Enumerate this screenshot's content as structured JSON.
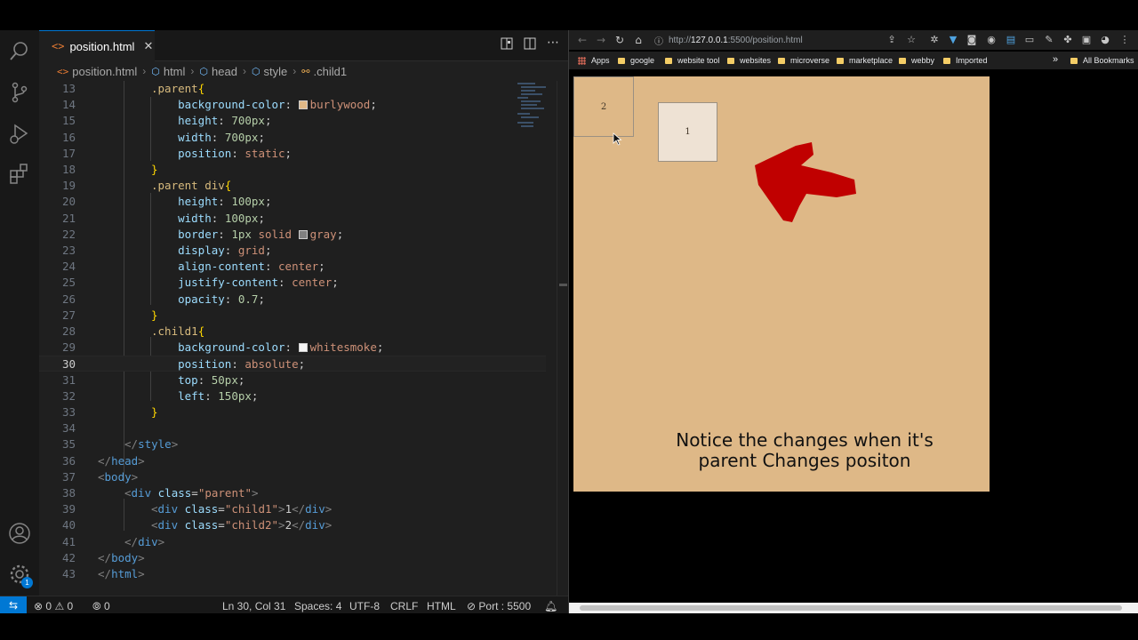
{
  "editor": {
    "tab": {
      "label": "position.html",
      "close": "✕"
    },
    "breadcrumb": [
      "position.html",
      "html",
      "head",
      "style",
      ".child1"
    ],
    "swatches": {
      "burlywood": "#deb887",
      "gray": "#808080",
      "whitesmoke": "#f5f5f5"
    },
    "lines": [
      {
        "n": "13",
        "html": "<span class=\"c-sel\">.parent</span><span class=\"c-brace\">{</span>"
      },
      {
        "n": "14",
        "html": "    <span class=\"c-prop\">background-color</span>: <span class=\"swatch\" style=\"background:#deb887\"></span><span class=\"c-val\">burlywood</span>;"
      },
      {
        "n": "15",
        "html": "    <span class=\"c-prop\">height</span>: <span class=\"c-num\">700px</span>;"
      },
      {
        "n": "16",
        "html": "    <span class=\"c-prop\">width</span>: <span class=\"c-num\">700px</span>;"
      },
      {
        "n": "17",
        "html": "    <span class=\"c-prop\">position</span>: <span class=\"c-val\">static</span>;"
      },
      {
        "n": "18",
        "html": "<span class=\"c-brace\">}</span>"
      },
      {
        "n": "19",
        "html": "<span class=\"c-sel\">.parent div</span><span class=\"c-brace\">{</span>"
      },
      {
        "n": "20",
        "html": "    <span class=\"c-prop\">height</span>: <span class=\"c-num\">100px</span>;"
      },
      {
        "n": "21",
        "html": "    <span class=\"c-prop\">width</span>: <span class=\"c-num\">100px</span>;"
      },
      {
        "n": "22",
        "html": "    <span class=\"c-prop\">border</span>: <span class=\"c-num\">1px</span> <span class=\"c-val\">solid</span> <span class=\"swatch\" style=\"background:#808080\"></span><span class=\"c-val\">gray</span>;"
      },
      {
        "n": "23",
        "html": "    <span class=\"c-prop\">display</span>: <span class=\"c-val\">grid</span>;"
      },
      {
        "n": "24",
        "html": "    <span class=\"c-prop\">align-content</span>: <span class=\"c-val\">center</span>;"
      },
      {
        "n": "25",
        "html": "    <span class=\"c-prop\">justify-content</span>: <span class=\"c-val\">center</span>;"
      },
      {
        "n": "26",
        "html": "    <span class=\"c-prop\">opacity</span>: <span class=\"c-num\">0.7</span>;"
      },
      {
        "n": "27",
        "html": "<span class=\"c-brace\">}</span>"
      },
      {
        "n": "28",
        "html": "<span class=\"c-sel\">.child1</span><span class=\"c-brace\">{</span>"
      },
      {
        "n": "29",
        "html": "    <span class=\"c-prop\">background-color</span>: <span class=\"swatch\" style=\"background:#f5f5f5\"></span><span class=\"c-val\">whitesmoke</span>;"
      },
      {
        "n": "30",
        "html": "    <span class=\"c-prop\">position</span>: <span class=\"c-val\">absolute</span>;"
      },
      {
        "n": "31",
        "html": "    <span class=\"c-prop\">top</span>: <span class=\"c-num\">50px</span>;"
      },
      {
        "n": "32",
        "html": "    <span class=\"c-prop\">left</span>: <span class=\"c-num\">150px</span>;"
      },
      {
        "n": "33",
        "html": "<span class=\"c-brace\">}</span>"
      },
      {
        "n": "34",
        "html": ""
      },
      {
        "n": "35",
        "html": "<span class=\"c-lt\">&lt;/</span><span class=\"c-tag\">style</span><span class=\"c-lt\">&gt;</span>"
      },
      {
        "n": "36",
        "html": "<span class=\"c-lt\">&lt;/</span><span class=\"c-tag\">head</span><span class=\"c-lt\">&gt;</span>"
      },
      {
        "n": "37",
        "html": "<span class=\"c-lt\">&lt;</span><span class=\"c-tag\">body</span><span class=\"c-lt\">&gt;</span>"
      },
      {
        "n": "38",
        "html": "<span class=\"c-lt\">&lt;</span><span class=\"c-tag\">div</span> <span class=\"c-attr\">class</span>=<span class=\"c-str\">\"parent\"</span><span class=\"c-lt\">&gt;</span>"
      },
      {
        "n": "39",
        "html": "<span class=\"c-lt\">&lt;</span><span class=\"c-tag\">div</span> <span class=\"c-attr\">class</span>=<span class=\"c-str\">\"child1\"</span><span class=\"c-lt\">&gt;</span><span class=\"c-text\">1</span><span class=\"c-lt\">&lt;/</span><span class=\"c-tag\">div</span><span class=\"c-lt\">&gt;</span>"
      },
      {
        "n": "40",
        "html": "<span class=\"c-lt\">&lt;</span><span class=\"c-tag\">div</span> <span class=\"c-attr\">class</span>=<span class=\"c-str\">\"child2\"</span><span class=\"c-lt\">&gt;</span><span class=\"c-text\">2</span><span class=\"c-lt\">&lt;/</span><span class=\"c-tag\">div</span><span class=\"c-lt\">&gt;</span>"
      },
      {
        "n": "41",
        "html": "<span class=\"c-lt\">&lt;/</span><span class=\"c-tag\">div</span><span class=\"c-lt\">&gt;</span>"
      },
      {
        "n": "42",
        "html": "<span class=\"c-lt\">&lt;/</span><span class=\"c-tag\">body</span><span class=\"c-lt\">&gt;</span>"
      },
      {
        "n": "43",
        "html": "<span class=\"c-lt\">&lt;/</span><span class=\"c-tag\">html</span><span class=\"c-lt\">&gt;</span>"
      }
    ],
    "current_line": "30",
    "status": {
      "errors": "0",
      "warnings": "0",
      "ports": "0",
      "position": "Ln 30, Col 31",
      "spaces": "Spaces: 4",
      "encoding": "UTF-8",
      "eol": "CRLF",
      "language": "HTML",
      "port": "Port : 5500"
    },
    "accounts_badge": "1"
  },
  "browser": {
    "url_prefix": "http://",
    "url_host": "127.0.0.1",
    "url_rest": ":5500/position.html",
    "bookmarks": [
      "Apps",
      "google",
      "website tool",
      "websites",
      "microverse",
      "marketplace",
      "webby",
      "Imported"
    ],
    "overflow": "»",
    "all_bookmarks": "All Bookmarks",
    "page": {
      "child1_text": "1",
      "child2_text": "2",
      "caption_line1": "Notice the changes when it's",
      "caption_line2": "parent Changes positon"
    }
  },
  "colors": {
    "accent": "#0078d4",
    "parent_bg": "#deb887",
    "arrow": "#c00000"
  }
}
